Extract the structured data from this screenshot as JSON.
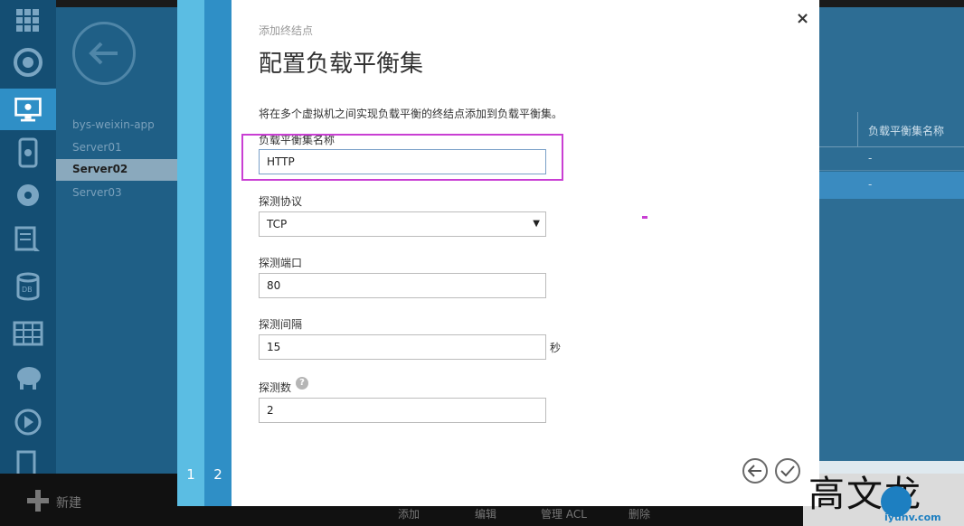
{
  "background": {
    "subnav": {
      "items": [
        "bys-weixin-app",
        "Server01",
        "Server02",
        "Server03"
      ],
      "selected": "Server02"
    },
    "right_column": {
      "header": "负载平衡集名称",
      "cells": [
        "-",
        "-"
      ]
    },
    "bottom": {
      "new_label": "新建",
      "actions": [
        "添加",
        "编辑",
        "管理 ACL",
        "删除"
      ]
    }
  },
  "wizard": {
    "steps": [
      "1",
      "2"
    ],
    "current_step": "2",
    "subtitle": "添加终结点",
    "title": "配置负载平衡集",
    "description": "将在多个虚拟机之间实现负载平衡的终结点添加到负载平衡集。",
    "fields": {
      "lb_name": {
        "label": "负载平衡集名称",
        "value": "HTTP"
      },
      "probe_protocol": {
        "label": "探测协议",
        "value": "TCP"
      },
      "probe_port": {
        "label": "探测端口",
        "value": "80"
      },
      "probe_interval": {
        "label": "探测间隔",
        "value": "15",
        "unit": "秒"
      },
      "probe_count": {
        "label": "探测数",
        "value": "2",
        "help": "?"
      }
    },
    "close_symbol": "×"
  },
  "watermark": {
    "author_text": "高文龙",
    "site_text": "iyunv.com"
  },
  "colors": {
    "highlight": "#c93fd3",
    "step1": "#5bbde3",
    "step2": "#2f8fc6",
    "nav": "#144e73"
  }
}
